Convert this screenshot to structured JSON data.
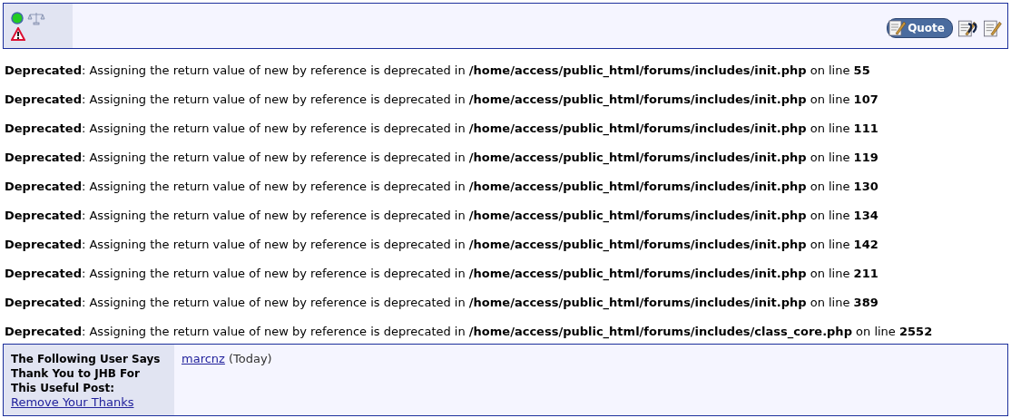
{
  "post_toolbar": {
    "user_online": true,
    "quote_button": "Quote"
  },
  "notices": [
    "**Deprecated**: Assigning the return value of new by reference is deprecated in **/home/access/public_html/forums/includes/init.php** on line **55**",
    "**Deprecated**: Assigning the return value of new by reference is deprecated in **/home/access/public_html/forums/includes/init.php** on line **107**",
    "**Deprecated**: Assigning the return value of new by reference is deprecated in **/home/access/public_html/forums/includes/init.php** on line **111**",
    "**Deprecated**: Assigning the return value of new by reference is deprecated in **/home/access/public_html/forums/includes/init.php** on line **119**",
    "**Deprecated**: Assigning the return value of new by reference is deprecated in **/home/access/public_html/forums/includes/init.php** on line **130**",
    "**Deprecated**: Assigning the return value of new by reference is deprecated in **/home/access/public_html/forums/includes/init.php** on line **134**",
    "**Deprecated**: Assigning the return value of new by reference is deprecated in **/home/access/public_html/forums/includes/init.php** on line **142**",
    "**Deprecated**: Assigning the return value of new by reference is deprecated in **/home/access/public_html/forums/includes/init.php** on line **211**",
    "**Deprecated**: Assigning the return value of new by reference is deprecated in **/home/access/public_html/forums/includes/init.php** on line **389**",
    "**Deprecated**: Assigning the return value of new by reference is deprecated in **/home/access/public_html/forums/includes/class_core.php** on line **2552**"
  ],
  "thanks": {
    "heading": "The Following User Says Thank You to JHB For This Useful Post:",
    "remove_link": "Remove Your Thanks",
    "users": [
      {
        "name": "marcnz",
        "when": "(Today)"
      }
    ]
  }
}
